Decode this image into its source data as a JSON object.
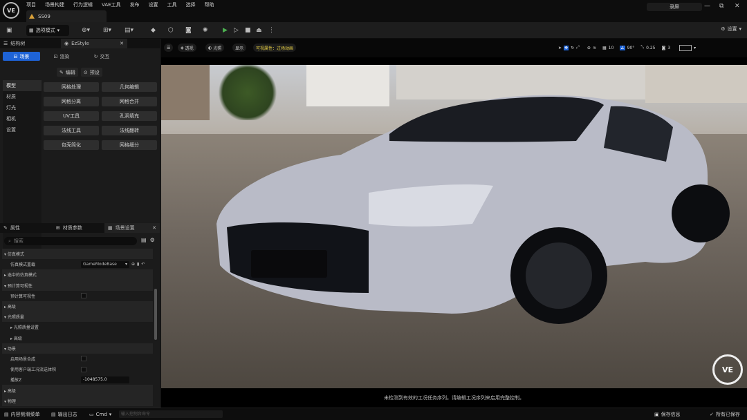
{
  "app": {
    "logo": "VE",
    "menu": [
      "项目",
      "场景构建",
      "行为逻辑",
      "VAE工具",
      "发布",
      "设置",
      "工具",
      "选择",
      "帮助"
    ],
    "doc_tab": "SS09",
    "live_label": "录屏",
    "win_controls": [
      "—",
      "⧉",
      "✕"
    ]
  },
  "toolbar": {
    "mode_label": "选项模式",
    "settings_label": "设置"
  },
  "left_panel": {
    "tabs": [
      "结构树",
      "EzStyle"
    ],
    "subtabs": [
      "场景",
      "渲染",
      "交互"
    ],
    "edit_label": "编辑",
    "preset_label": "预设",
    "categories": [
      "模型",
      "材质",
      "灯光",
      "相机",
      "设置"
    ],
    "tools": [
      "网格处理",
      "几何编辑",
      "网格分离",
      "网格合并",
      "UV工具",
      "孔洞填充",
      "法线工具",
      "法线翻转",
      "包壳简化",
      "网格细分"
    ]
  },
  "bottom_panel": {
    "tabs": [
      "属性",
      "材质参数",
      "场景设置"
    ],
    "search_placeholder": "搜索",
    "rows": [
      {
        "label": "仿真模式",
        "kind": "section"
      },
      {
        "label": "仿真模式重载",
        "kind": "sub",
        "value_type": "dropdown",
        "value": "GameModeBase"
      },
      {
        "label": "选中的仿真模式",
        "kind": "sub"
      },
      {
        "label": "预计算可视性",
        "kind": "section"
      },
      {
        "label": "预计算可视性",
        "kind": "sub",
        "value_type": "checkbox"
      },
      {
        "label": "高级",
        "kind": "section"
      },
      {
        "label": "光照质量",
        "kind": "section"
      },
      {
        "label": "光照质量设置",
        "kind": "sub"
      },
      {
        "label": "高级",
        "kind": "sub"
      },
      {
        "label": "场景",
        "kind": "section"
      },
      {
        "label": "启用场景合成",
        "kind": "sub",
        "value_type": "checkbox"
      },
      {
        "label": "使用客户端工况流送体积",
        "kind": "sub",
        "value_type": "checkbox"
      },
      {
        "label": "播放Z",
        "kind": "sub",
        "value_type": "number",
        "value": "-1048575.0"
      },
      {
        "label": "高级",
        "kind": "sub"
      },
      {
        "label": "物理",
        "kind": "section"
      }
    ]
  },
  "viewport": {
    "buttons": [
      "透视",
      "光照",
      "显示"
    ],
    "highlight": "可视属性：过场动画",
    "right_values": {
      "grid": "10",
      "angle": "90°",
      "scale": "0.25",
      "cams": "3"
    },
    "logo": "VE",
    "status": "未检测到有效的工况任务序列。请编辑工况序列来启用完整控制。"
  },
  "statusbar": {
    "items": [
      "内容侧滑菜单",
      "输出日志",
      "Cmd"
    ],
    "cmd_placeholder": "输入控制台命令",
    "save_info": "保存信息",
    "saved": "所有已保存"
  }
}
